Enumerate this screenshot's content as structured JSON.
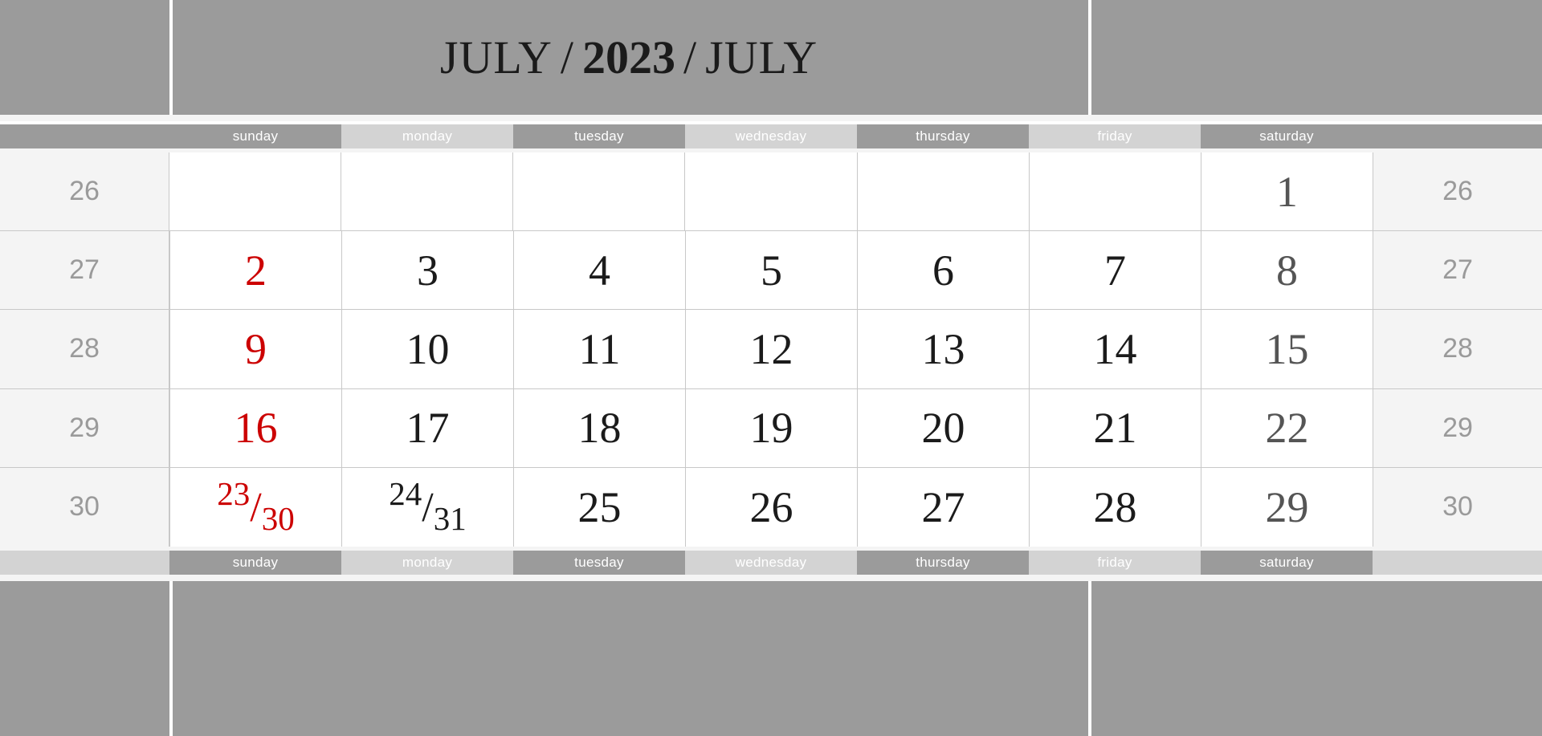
{
  "header": {
    "month_left": "JULY",
    "separator": "/",
    "year": "2023",
    "month_right": "JULY"
  },
  "weekday_headers": [
    {
      "label": "sunday",
      "shade": "dark"
    },
    {
      "label": "monday",
      "shade": "lite"
    },
    {
      "label": "tuesday",
      "shade": "dark"
    },
    {
      "label": "wednesday",
      "shade": "lite"
    },
    {
      "label": "thursday",
      "shade": "dark"
    },
    {
      "label": "friday",
      "shade": "lite"
    },
    {
      "label": "saturday",
      "shade": "dark"
    }
  ],
  "week_numbers": [
    "26",
    "27",
    "28",
    "29",
    "30"
  ],
  "weeks": [
    {
      "week_number": "26",
      "days": [
        {
          "text": "",
          "kind": "empty"
        },
        {
          "text": "",
          "kind": "empty"
        },
        {
          "text": "",
          "kind": "empty"
        },
        {
          "text": "",
          "kind": "empty"
        },
        {
          "text": "",
          "kind": "empty"
        },
        {
          "text": "",
          "kind": "empty"
        },
        {
          "text": "1",
          "kind": "saturday"
        }
      ]
    },
    {
      "week_number": "27",
      "days": [
        {
          "text": "2",
          "kind": "sunday"
        },
        {
          "text": "3",
          "kind": "weekday"
        },
        {
          "text": "4",
          "kind": "weekday"
        },
        {
          "text": "5",
          "kind": "weekday"
        },
        {
          "text": "6",
          "kind": "weekday"
        },
        {
          "text": "7",
          "kind": "weekday"
        },
        {
          "text": "8",
          "kind": "saturday"
        }
      ]
    },
    {
      "week_number": "28",
      "days": [
        {
          "text": "9",
          "kind": "sunday"
        },
        {
          "text": "10",
          "kind": "weekday"
        },
        {
          "text": "11",
          "kind": "weekday"
        },
        {
          "text": "12",
          "kind": "weekday"
        },
        {
          "text": "13",
          "kind": "weekday"
        },
        {
          "text": "14",
          "kind": "weekday"
        },
        {
          "text": "15",
          "kind": "saturday"
        }
      ]
    },
    {
      "week_number": "29",
      "days": [
        {
          "text": "16",
          "kind": "sunday"
        },
        {
          "text": "17",
          "kind": "weekday"
        },
        {
          "text": "18",
          "kind": "weekday"
        },
        {
          "text": "19",
          "kind": "weekday"
        },
        {
          "text": "20",
          "kind": "weekday"
        },
        {
          "text": "21",
          "kind": "weekday"
        },
        {
          "text": "22",
          "kind": "saturday"
        }
      ]
    },
    {
      "week_number": "30",
      "days": [
        {
          "text": "23/30",
          "kind": "sunday",
          "fraction": {
            "top": "23",
            "slash": "/",
            "bottom": "30"
          }
        },
        {
          "text": "24/31",
          "kind": "weekday",
          "fraction": {
            "top": "24",
            "slash": "/",
            "bottom": "31"
          }
        },
        {
          "text": "25",
          "kind": "weekday"
        },
        {
          "text": "26",
          "kind": "weekday"
        },
        {
          "text": "27",
          "kind": "weekday"
        },
        {
          "text": "28",
          "kind": "weekday"
        },
        {
          "text": "29",
          "kind": "saturday"
        }
      ]
    }
  ],
  "colors": {
    "header_band": "#9b9b9b",
    "weekday_dark": "#9b9b9b",
    "weekday_lite": "#d3d3d3",
    "sunday_red": "#cc0000",
    "saturday_gray": "#555555",
    "weekday_black": "#1b1b1b",
    "week_number_gray": "#9a9a9a",
    "week_number_bg": "#f4f4f4",
    "cell_bg": "#ffffff",
    "grid_line": "#c8c8c8"
  }
}
